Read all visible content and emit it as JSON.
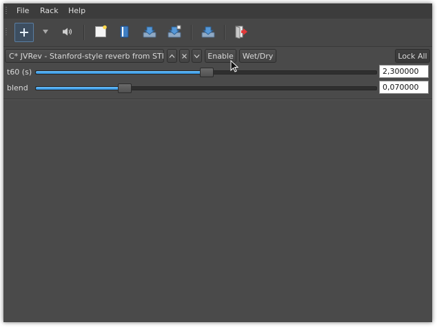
{
  "menu": {
    "items": [
      "File",
      "Rack",
      "Help"
    ]
  },
  "toolbar": {
    "icons": [
      "add-icon",
      "dropdown-arrow-icon",
      "speaker-icon",
      "new-document-icon",
      "open-book-icon",
      "save-icon",
      "save-as-icon",
      "import-icon",
      "exit-icon"
    ]
  },
  "plugin": {
    "name": "C* JVRev - Stanford-style reverb from STK",
    "up_label": "^",
    "close_label": "x",
    "down_label": "v",
    "enable_label": "Enable",
    "wetdry_label": "Wet/Dry",
    "lockall_label": "Lock All"
  },
  "params": [
    {
      "label": "t60 (s)",
      "value": "2,300000",
      "fraction": 0.5
    },
    {
      "label": "blend",
      "value": "0,070000",
      "fraction": 0.26
    }
  ],
  "colors": {
    "accent": "#3a9be8",
    "background": "#4a4a4a"
  }
}
